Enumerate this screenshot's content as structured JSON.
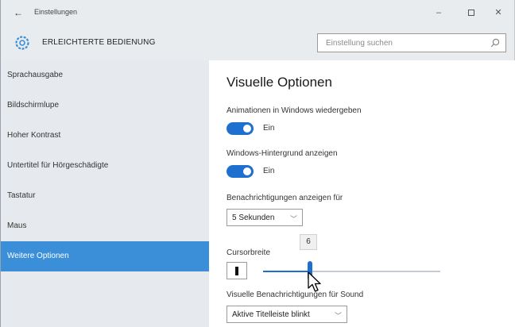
{
  "window": {
    "title": "Einstellungen",
    "back_icon": "back-arrow-icon",
    "minimize_symbol": "–",
    "close_symbol": "✕"
  },
  "header": {
    "title": "ERLEICHTERTE BEDIENUNG",
    "icon": "gear-icon",
    "search_placeholder": "Einstellung suchen"
  },
  "sidebar": {
    "items": [
      {
        "label": "Sprachausgabe"
      },
      {
        "label": "Bildschirmlupe"
      },
      {
        "label": "Hoher Kontrast"
      },
      {
        "label": "Untertitel für Hörgeschädigte"
      },
      {
        "label": "Tastatur"
      },
      {
        "label": "Maus"
      },
      {
        "label": "Weitere Optionen",
        "active": true
      }
    ]
  },
  "main": {
    "heading": "Visuelle Optionen",
    "animations": {
      "label": "Animationen in Windows wiedergeben",
      "state": "Ein",
      "on": true
    },
    "background": {
      "label": "Windows-Hintergrund anzeigen",
      "state": "Ein",
      "on": true
    },
    "notifications": {
      "label": "Benachrichtigungen anzeigen für",
      "value": "5 Sekunden"
    },
    "cursor": {
      "label": "Cursorbreite",
      "value": "6",
      "min": 1,
      "max": 20
    },
    "sound": {
      "label": "Visuelle Benachrichtigungen für Sound",
      "value": "Aktive Titelleiste blinkt"
    }
  },
  "colors": {
    "accent": "#1f6fd1",
    "sidebar_active": "#3a8fd8",
    "sidebar_bg": "#e6eaee",
    "titlebar_bg": "#e9ecef"
  }
}
